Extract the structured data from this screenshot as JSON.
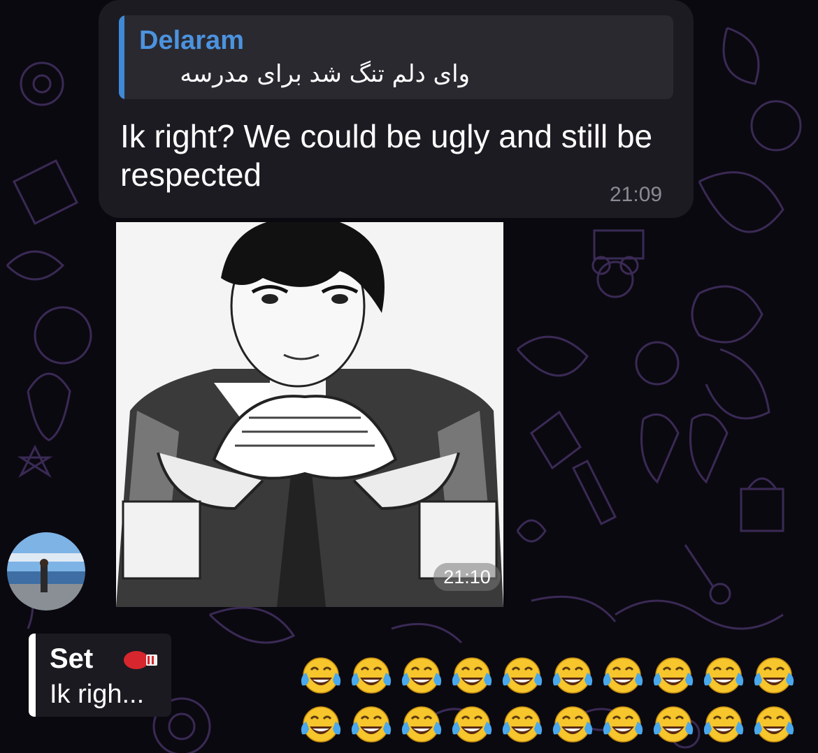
{
  "message": {
    "reply_to": {
      "sender": "Delaram",
      "text": "وای دلم تنگ شد برای مدرسه"
    },
    "text": "Ik right? We could be ugly and still be respected",
    "time": "21:09"
  },
  "photo_message": {
    "description_icon": "manga-portrait",
    "time": "21:10"
  },
  "composer_reply": {
    "name": "Set",
    "name_emoji": "boxing-glove-icon",
    "preview": "Ik righ..."
  },
  "emoji_rows": [
    [
      "😂",
      "😂",
      "😂",
      "😂",
      "😂",
      "😂",
      "😂",
      "😂",
      "😂",
      "😂"
    ],
    [
      "😂",
      "😂",
      "😂",
      "😂",
      "😂",
      "😂",
      "😂",
      "😂",
      "😂",
      "😂"
    ]
  ],
  "colors": {
    "background": "#0b0910",
    "pattern": "#3a2a55",
    "bubble": "#1d1b22",
    "reply_accent": "#3f8ad6",
    "reply_name": "#4c93df",
    "timestamp": "#8b8993"
  }
}
